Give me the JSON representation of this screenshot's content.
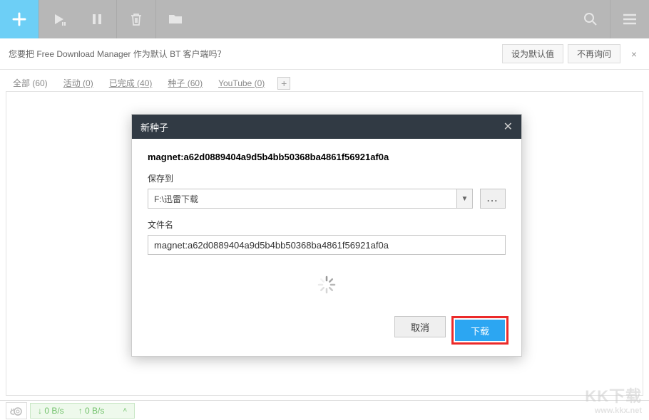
{
  "banner": {
    "text": "您要把 Free Download Manager 作为默认 BT 客户端吗？",
    "set_default": "设为默认值",
    "no_ask": "不再询问"
  },
  "tabs": [
    {
      "label": "全部 (60)"
    },
    {
      "label": "活动 (0)"
    },
    {
      "label": "已完成 (40)"
    },
    {
      "label": "种子 (60)"
    },
    {
      "label": "YouTube (0)"
    }
  ],
  "modal": {
    "title": "新种子",
    "magnet": "magnet:a62d0889404a9d5b4bb50368ba4861f56921af0a",
    "save_to_label": "保存到",
    "save_path": "F:\\迅雷下载",
    "filename_label": "文件名",
    "filename_value": "magnet:a62d0889404a9d5b4bb50368ba4861f56921af0a",
    "browse": "...",
    "cancel": "取消",
    "download": "下载"
  },
  "status": {
    "down": "↓  0 B/s",
    "up": "↑  0 B/s"
  },
  "watermark": {
    "line1": "KK下载",
    "line2": "www.kkx.net"
  }
}
